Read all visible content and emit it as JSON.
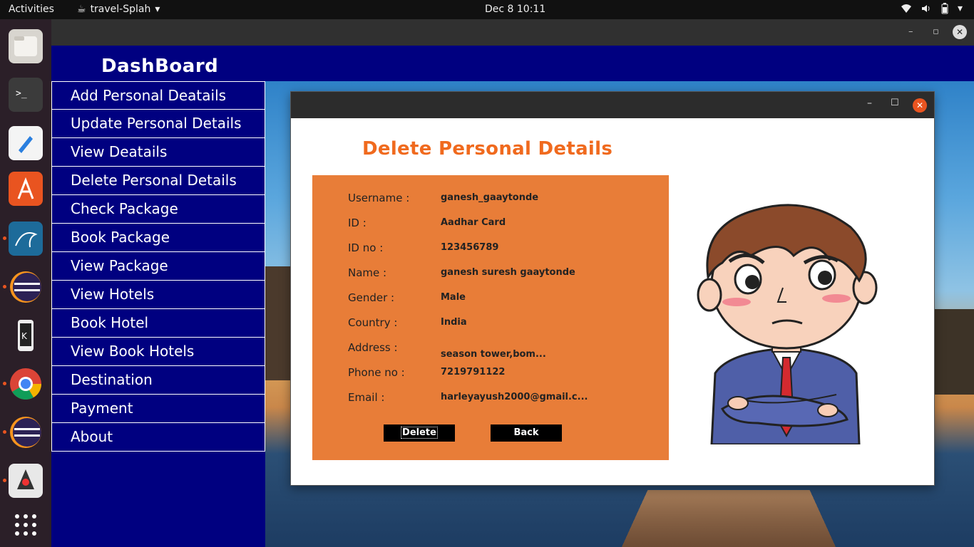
{
  "topbar": {
    "activities": "Activities",
    "app_name": "travel-Splah",
    "clock": "Dec 8  10:11"
  },
  "dock": {
    "items": [
      "files-icon",
      "terminal-icon",
      "text-editor-icon",
      "app-center-icon",
      "mysql-workbench-icon",
      "eclipse-icon",
      "kde-connect-icon",
      "chrome-icon",
      "eclipse-icon-2",
      "java-icon",
      "show-apps-icon"
    ]
  },
  "dashboard": {
    "title": "DashBoard",
    "menu": [
      "Add Personal Deatails",
      "Update Personal Details",
      "View Deatails",
      "Delete Personal Details",
      "Check Package",
      "Book Package",
      "View Package",
      "View Hotels",
      "Book Hotel",
      "View Book Hotels",
      "Destination",
      "Payment",
      "About"
    ]
  },
  "dialog": {
    "heading": "Delete Personal Details",
    "fields": [
      {
        "label": "Username :",
        "value": "ganesh_gaaytonde"
      },
      {
        "label": "ID :",
        "value": "Aadhar Card"
      },
      {
        "label": "ID no :",
        "value": "123456789"
      },
      {
        "label": "Name :",
        "value": "ganesh suresh gaaytonde"
      },
      {
        "label": "Gender :",
        "value": "Male"
      },
      {
        "label": "Country :",
        "value": "India"
      },
      {
        "label": "Address :",
        "value": "season tower,bom..."
      },
      {
        "label": "Phone no :",
        "value": "7219791122"
      },
      {
        "label": "Email :",
        "value": "harleyayush2000@gmail.c..."
      }
    ],
    "delete_label": "Delete",
    "back_label": "Back"
  },
  "colors": {
    "nav_bg": "#000080",
    "panel": "#e87d38",
    "heading": "#f06a1e",
    "close": "#e95420"
  }
}
